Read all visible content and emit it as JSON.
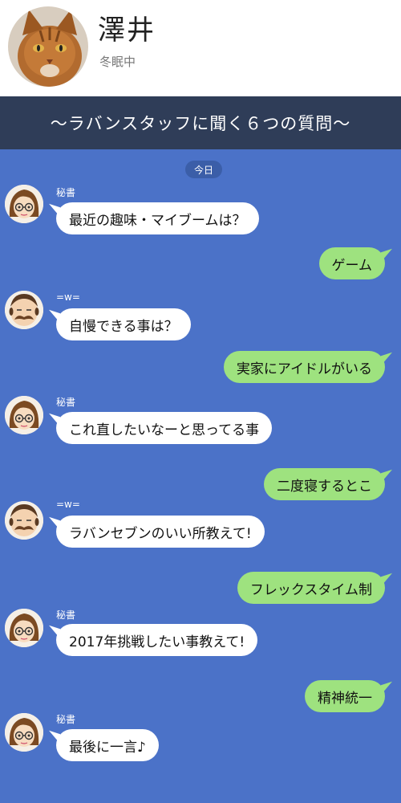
{
  "header": {
    "name": "澤井",
    "status": "冬眠中",
    "photo": "cat-avatar-icon"
  },
  "banner": {
    "title": "〜ラバンスタッフに聞く６つの質問〜"
  },
  "chat": {
    "date_label": "今日",
    "messages": [
      {
        "side": "in",
        "sender": "秘書",
        "avatar": "secretary-avatar-icon",
        "text": "最近の趣味・マイブームは？"
      },
      {
        "side": "out",
        "text": "ゲーム"
      },
      {
        "side": "in",
        "sender": "=w=",
        "avatar": "mustache-man-avatar-icon",
        "text": "自慢できる事は？"
      },
      {
        "side": "out",
        "text": "実家にアイドルがいる"
      },
      {
        "side": "in",
        "sender": "秘書",
        "avatar": "secretary-avatar-icon",
        "text": "これ直したいなーと思ってる事"
      },
      {
        "side": "out",
        "text": "二度寝するとこ"
      },
      {
        "side": "in",
        "sender": "=w=",
        "avatar": "mustache-man-avatar-icon",
        "text": "ラバンセブンのいい所教えて!"
      },
      {
        "side": "out",
        "text": "フレックスタイム制"
      },
      {
        "side": "in",
        "sender": "秘書",
        "avatar": "secretary-avatar-icon",
        "text": "2017年挑戦したい事教えて!"
      },
      {
        "side": "out",
        "text": "精神統一"
      },
      {
        "side": "in",
        "sender": "秘書",
        "avatar": "secretary-avatar-icon",
        "text": "最後に一言♪"
      }
    ]
  },
  "colors": {
    "chat_background": "#4b72c8",
    "banner_background": "#2f3d58",
    "outgoing_bubble": "#9ee27f",
    "incoming_bubble": "#ffffff"
  }
}
